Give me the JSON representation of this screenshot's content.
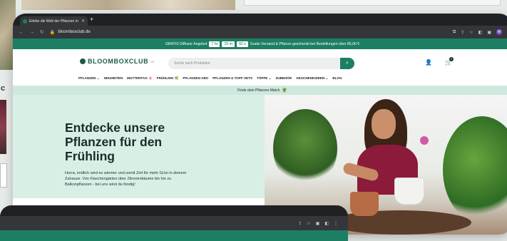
{
  "browser": {
    "tab_title": "Erlebe die Welt der Pflanzen m",
    "url": "bloomboxclub.de",
    "profile_initial": "M"
  },
  "promo": {
    "prefix": "GRATIS Diffusor Angebot",
    "timer_hours": "7 hr",
    "timer_minutes": "15 m",
    "timer_seconds": "42 s",
    "suffix": "Gratis Versand & Pflanze geschenkt bei Bestellungen über 85,00 €"
  },
  "header": {
    "logo_text": "BLOOMBOXCLUB",
    "logo_suffix": "DE",
    "search_placeholder": "Suche nach Produkten",
    "cart_count": "0"
  },
  "nav": {
    "items": [
      "PFLANZEN ⌄",
      "NEUHEITEN",
      "MUTTERTAG 🌸",
      "FRÜHLING 🌿",
      "PFLANZEN ABO",
      "PFLANZEN & TOPF SETS",
      "TÖPFE ⌄",
      "ZUBEHÖR",
      "GESCHENKIDEEN ⌄",
      "BLOG"
    ]
  },
  "match_bar": {
    "text": "Finde dein Pflanzen Match"
  },
  "hero": {
    "title": "Entdecke unsere\nPflanzen für den\nFrühling",
    "text": "Hurra, endlich wird es wärmer und somit Zeit für mehr Grün in deinem\nZuhause. Von Flaschengärten über Zitronenbäume bis hin zu\nBalkonpflanzen - bei uns wirst du fündig!"
  },
  "colors": {
    "brand_green": "#1c7f64",
    "dark_green": "#1c5a48",
    "hero_bg": "#d8efe5"
  },
  "icons": [
    "back-icon",
    "forward-icon",
    "reload-icon",
    "lock-icon",
    "share-icon",
    "bookmark-icon",
    "extensions-icon",
    "search-icon",
    "user-icon",
    "cart-icon",
    "plant-icon"
  ]
}
